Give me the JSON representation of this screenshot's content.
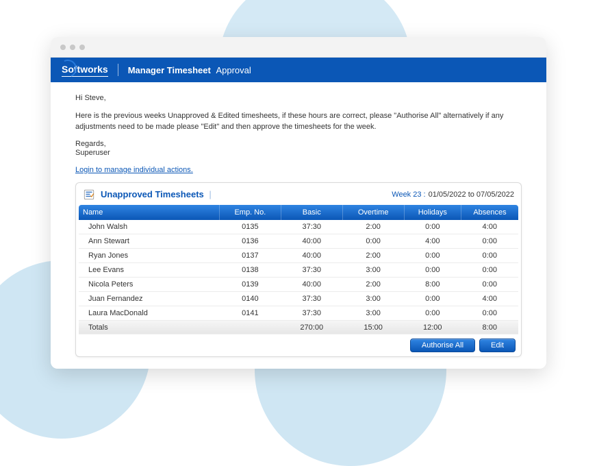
{
  "header": {
    "brand": "Softworks",
    "title_strong": "Manager Timesheet",
    "title_light": "Approval"
  },
  "message": {
    "greeting": "Hi Steve,",
    "body": "Here is the previous weeks Unapproved & Edited timesheets, if these hours are correct, please \"Authorise All\" alternatively if any adjustments need to be made please \"Edit\" and then approve the timesheets for the week.",
    "regards": "Regards,",
    "sender": "Superuser",
    "login_link": "Login to manage individual actions."
  },
  "panel": {
    "title": "Unapproved Timesheets",
    "week_label": "Week 23 :",
    "week_range": "01/05/2022 to 07/05/2022"
  },
  "columns": [
    "Name",
    "Emp. No.",
    "Basic",
    "Overtime",
    "Holidays",
    "Absences"
  ],
  "rows": [
    {
      "name": "John Walsh",
      "emp": "0135",
      "basic": "37:30",
      "ot": "2:00",
      "hol": "0:00",
      "abs": "4:00"
    },
    {
      "name": "Ann Stewart",
      "emp": "0136",
      "basic": "40:00",
      "ot": "0:00",
      "hol": "4:00",
      "abs": "0:00"
    },
    {
      "name": "Ryan Jones",
      "emp": "0137",
      "basic": "40:00",
      "ot": "2:00",
      "hol": "0:00",
      "abs": "0:00"
    },
    {
      "name": "Lee Evans",
      "emp": "0138",
      "basic": "37:30",
      "ot": "3:00",
      "hol": "0:00",
      "abs": "0:00"
    },
    {
      "name": "Nicola Peters",
      "emp": "0139",
      "basic": "40:00",
      "ot": "2:00",
      "hol": "8:00",
      "abs": "0:00"
    },
    {
      "name": "Juan Fernandez",
      "emp": "0140",
      "basic": "37:30",
      "ot": "3:00",
      "hol": "0:00",
      "abs": "4:00"
    },
    {
      "name": "Laura MacDonald",
      "emp": "0141",
      "basic": "37:30",
      "ot": "3:00",
      "hol": "0:00",
      "abs": "0:00"
    }
  ],
  "totals": {
    "label": "Totals",
    "basic": "270:00",
    "ot": "15:00",
    "hol": "12:00",
    "abs": "8:00"
  },
  "buttons": {
    "authorise": "Authorise All",
    "edit": "Edit"
  }
}
